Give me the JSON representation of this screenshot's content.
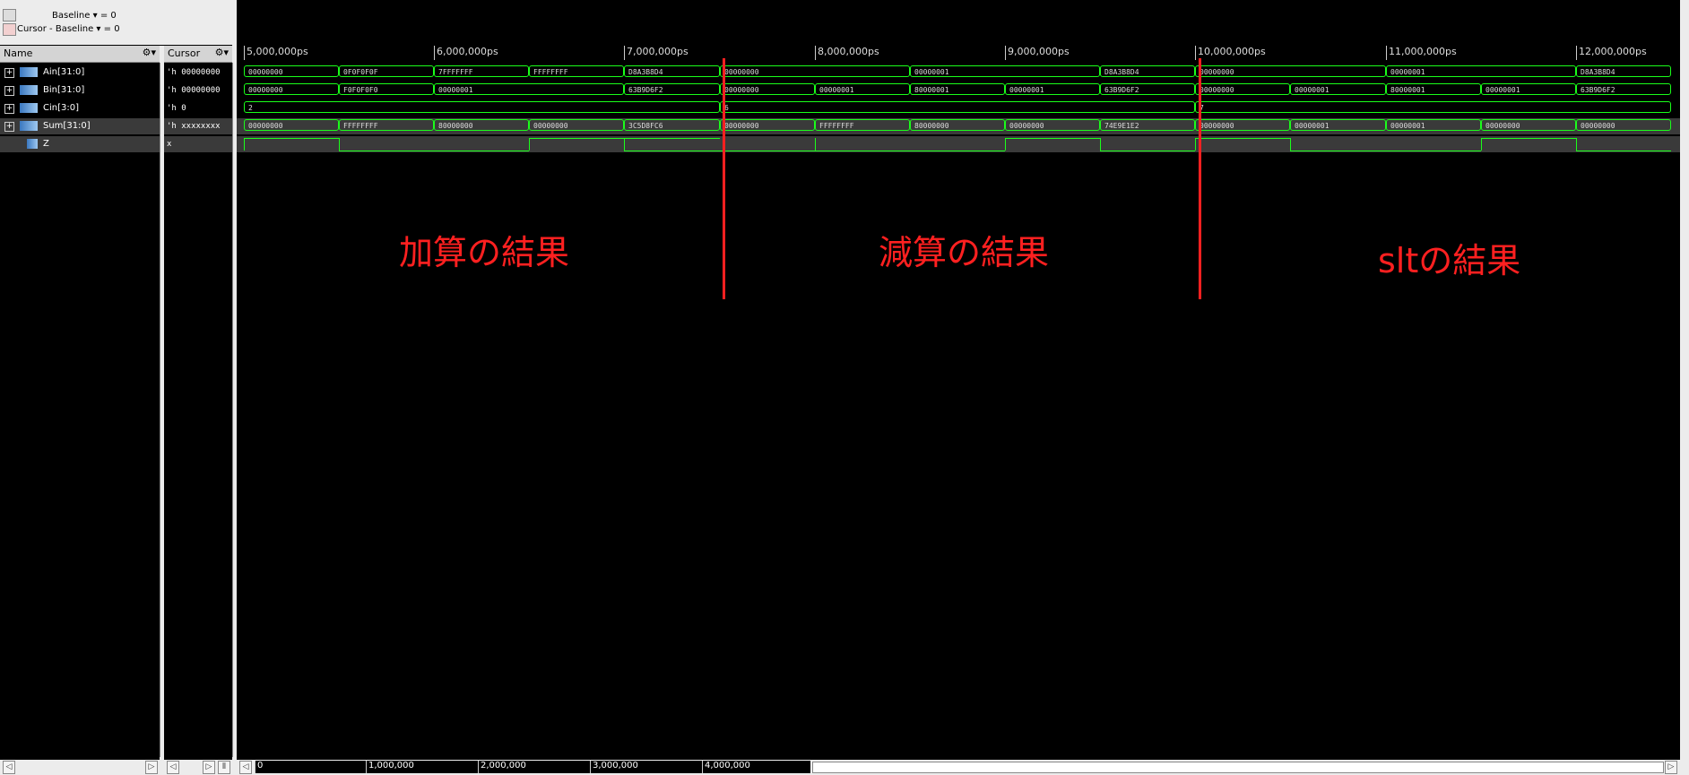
{
  "toolbar": {
    "baseline_label": "Baseline",
    "baseline_value": "= 0",
    "cursor_baseline_label": "Cursor - Baseline",
    "cursor_baseline_value": "= 0"
  },
  "name_column": {
    "header": "Name"
  },
  "cursor_column": {
    "header": "Cursor"
  },
  "signals": [
    {
      "name": "Ain[31:0]",
      "cursor_value": "'h 00000000",
      "expandable": true
    },
    {
      "name": "Bin[31:0]",
      "cursor_value": "'h 00000000",
      "expandable": true
    },
    {
      "name": "Cin[3:0]",
      "cursor_value": "'h 0",
      "expandable": true
    },
    {
      "name": "Sum[31:0]",
      "cursor_value": "'h xxxxxxxx",
      "expandable": true
    },
    {
      "name": "Z",
      "cursor_value": "x",
      "expandable": false
    }
  ],
  "ruler_ticks": [
    "5,000,000ps",
    "6,000,000ps",
    "7,000,000ps",
    "8,000,000ps",
    "9,000,000ps",
    "10,000,000ps",
    "11,000,000ps",
    "12,000,000ps"
  ],
  "waveforms": {
    "ain": [
      "00000000",
      "0F0F0F0F",
      "7FFFFFFF",
      "FFFFFFFF",
      "D8A3B8D4",
      "00000000",
      "00000001",
      "D8A3B8D4",
      "00000000",
      "00000001",
      "D8A3B8D4"
    ],
    "bin": [
      "00000000",
      "F0F0F0F0",
      "00000001",
      "63B9D6F2",
      "00000000",
      "00000001",
      "80000001",
      "00000001",
      "63B9D6F2",
      "00000000",
      "00000001",
      "80000001",
      "00000001",
      "63B9D6F2"
    ],
    "cin": [
      "2",
      "6",
      "7"
    ],
    "sum": [
      "00000000",
      "FFFFFFFF",
      "80000000",
      "00000000",
      "3C5D8FC6",
      "00000000",
      "FFFFFFFF",
      "80000000",
      "00000000",
      "74E9E1E2",
      "00000000",
      "00000001",
      "00000001",
      "00000000",
      "00000000"
    ]
  },
  "annotations": {
    "add": "加算の結果",
    "sub": "減算の結果",
    "slt": "sltの結果"
  },
  "colors": {
    "wave": "#1aff1a",
    "annotation": "#ff2020",
    "background": "#000000"
  },
  "timeline": {
    "ticks": [
      "0",
      "1,000,000",
      "2,000,000",
      "3,000,000",
      "4,000,000"
    ]
  }
}
